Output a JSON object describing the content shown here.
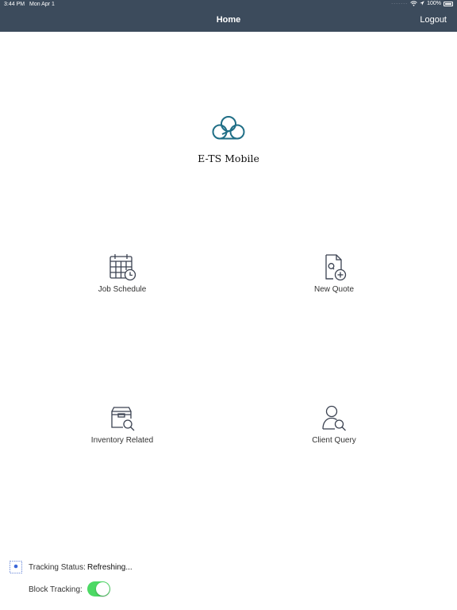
{
  "status_bar": {
    "time": "3:44 PM",
    "date": "Mon Apr 1",
    "battery": "100%",
    "icons": [
      "wifi-icon",
      "location-icon",
      "battery-icon"
    ]
  },
  "nav": {
    "title": "Home",
    "logout_label": "Logout"
  },
  "app": {
    "name": "E-TS Mobile",
    "logo_icon": "cloud-logo-icon"
  },
  "tiles": [
    {
      "label": "Job Schedule",
      "icon": "calendar-clock-icon"
    },
    {
      "label": "New Quote",
      "icon": "document-add-icon"
    },
    {
      "label": "Inventory Related",
      "icon": "box-search-icon"
    },
    {
      "label": "Client Query",
      "icon": "user-search-icon"
    }
  ],
  "tracking": {
    "status_label": "Tracking Status:",
    "status_value": "Refreshing...",
    "block_label": "Block Tracking:",
    "block_enabled": true
  },
  "colors": {
    "nav_bg": "#3c4b5c",
    "logo": "#1f6e86",
    "icon": "#3a4150",
    "toggle_on": "#4cd964"
  }
}
